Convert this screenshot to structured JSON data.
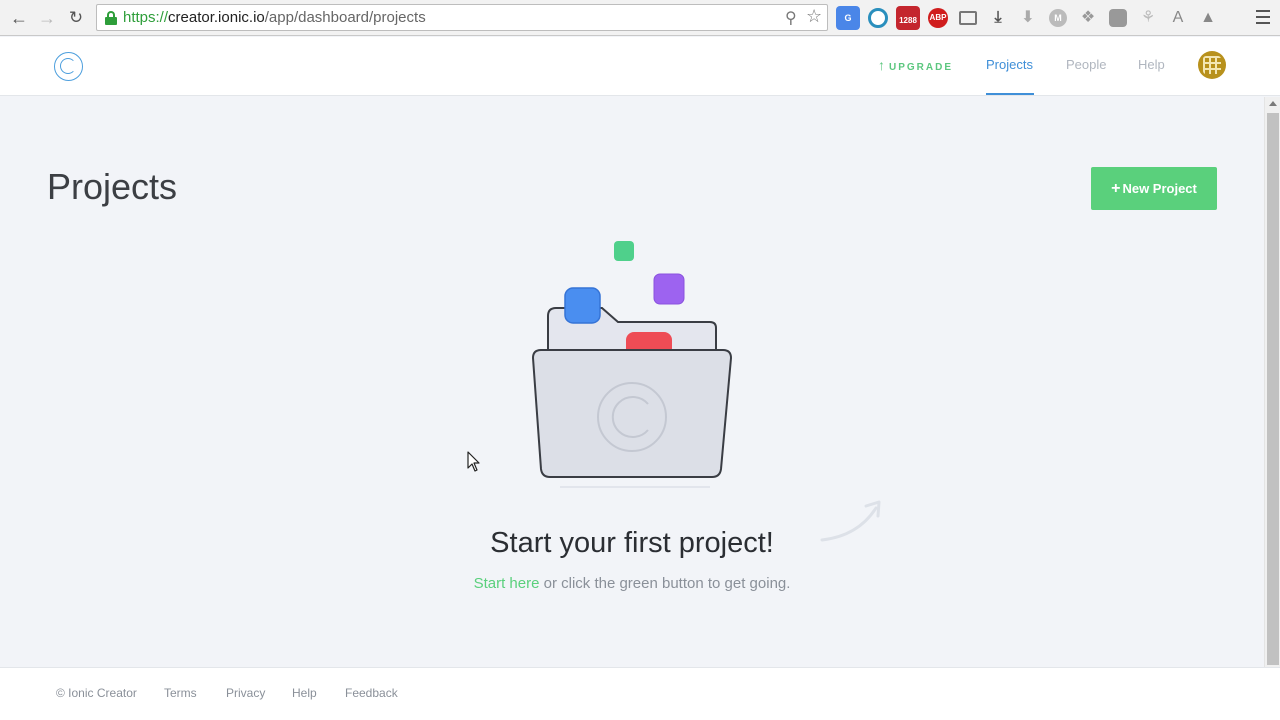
{
  "browser": {
    "url_scheme": "https://",
    "url_host": "creator.ionic.io",
    "url_path": "/app/dashboard/projects",
    "extension_badge": "1288",
    "abp_label": "ABP"
  },
  "header": {
    "upgrade_label": "UPGRADE",
    "nav": [
      {
        "label": "Projects",
        "active": true
      },
      {
        "label": "People",
        "active": false
      },
      {
        "label": "Help",
        "active": false
      }
    ],
    "accent_color": "#3f8fd8"
  },
  "main": {
    "title": "Projects",
    "new_project_label": "New Project",
    "headline": "Start your first project!",
    "start_link": "Start here",
    "subline_rest": " or click the green button to get going."
  },
  "footer": {
    "links": [
      "© Ionic Creator",
      "Terms",
      "Privacy",
      "Help",
      "Feedback"
    ]
  },
  "colors": {
    "brand_green": "#5ad07c",
    "brand_blue": "#4d9fdd"
  }
}
